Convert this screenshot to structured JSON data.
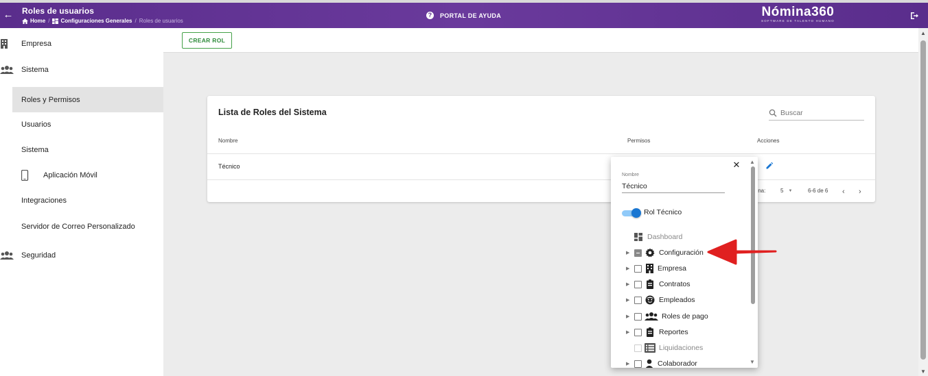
{
  "header": {
    "title": "Roles de usuarios",
    "breadcrumb": {
      "home": "Home",
      "section": "Configuraciones Generales",
      "current": "Roles de usuarios",
      "separator": "/"
    },
    "help_label": "PORTAL DE AYUDA",
    "logo_main": "Nómina360",
    "logo_sub": "SOFTWARE DE TALENTO HUMANO",
    "brand_color": "#5a2d8c"
  },
  "sidebar": {
    "items": [
      {
        "label": "Empresa",
        "icon": "building-icon"
      },
      {
        "label": "Sistema",
        "icon": "group-icon"
      },
      {
        "label": "Roles y Permisos",
        "active": true
      },
      {
        "label": "Usuarios"
      },
      {
        "label": "Sistema"
      },
      {
        "label": "Aplicación Móvil",
        "icon": "phone-icon"
      },
      {
        "label": "Integraciones"
      },
      {
        "label": "Servidor de Correo Personalizado"
      },
      {
        "label": "Seguridad",
        "icon": "group-icon"
      }
    ]
  },
  "toolbar": {
    "create_label": "CREAR ROL",
    "accent_color": "#43a047"
  },
  "card": {
    "title": "Lista de Roles del Sistema",
    "search_placeholder": "Buscar",
    "columns": [
      "Nombre",
      "Permisos",
      "Acciones"
    ],
    "rows": [
      {
        "name": "Técnico"
      }
    ],
    "pagination": {
      "rows_label": "gina:",
      "rows_per_page": "5",
      "range": "6-6 de 6"
    }
  },
  "popup": {
    "field_label": "Nombre",
    "field_value": "Técnico",
    "toggle_label": "Rol Técnico",
    "toggle_on": true,
    "accent_color": "#1976d2",
    "tree": [
      {
        "label": "Dashboard",
        "icon": "dashboard-icon",
        "expandable": false,
        "checkbox": "none",
        "disabled": true
      },
      {
        "label": "Configuración",
        "icon": "gear-icon",
        "expandable": true,
        "checkbox": "indeterminate"
      },
      {
        "label": "Empresa",
        "icon": "building-icon",
        "expandable": true,
        "checkbox": "unchecked"
      },
      {
        "label": "Contratos",
        "icon": "clipboard-icon",
        "expandable": true,
        "checkbox": "unchecked"
      },
      {
        "label": "Empleados",
        "icon": "face-icon",
        "expandable": true,
        "checkbox": "unchecked"
      },
      {
        "label": "Roles de pago",
        "icon": "group-icon",
        "expandable": true,
        "checkbox": "unchecked"
      },
      {
        "label": "Reportes",
        "icon": "clipboard-icon",
        "expandable": true,
        "checkbox": "unchecked"
      },
      {
        "label": "Liquidaciones",
        "icon": "list-icon",
        "expandable": false,
        "checkbox": "disabled",
        "disabled": true
      },
      {
        "label": "Colaborador",
        "icon": "person-icon",
        "expandable": true,
        "checkbox": "unchecked"
      }
    ]
  },
  "annotation": {
    "arrow_color": "#e02020"
  }
}
